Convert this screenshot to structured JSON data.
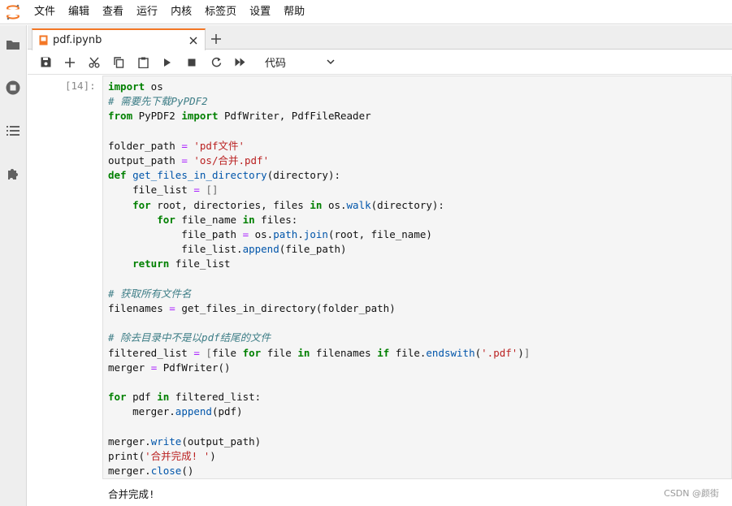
{
  "menu": [
    "文件",
    "编辑",
    "查看",
    "运行",
    "内核",
    "标签页",
    "设置",
    "帮助"
  ],
  "tab": {
    "title": "pdf.ipynb"
  },
  "toolbar": {
    "cell_type": "代码"
  },
  "cell": {
    "prompt": "[14]:",
    "output": "合并完成!"
  },
  "code_lines": [
    "import os",
    "# 需要先下载PyPDF2",
    "from PyPDF2 import PdfWriter, PdfFileReader",
    "",
    "folder_path = 'pdf文件'",
    "output_path = 'os/合并.pdf'",
    "def get_files_in_directory(directory):",
    "    file_list = []",
    "    for root, directories, files in os.walk(directory):",
    "        for file_name in files:",
    "            file_path = os.path.join(root, file_name)",
    "            file_list.append(file_path)",
    "    return file_list",
    "",
    "# 获取所有文件名",
    "filenames = get_files_in_directory(folder_path)",
    "",
    "# 除去目录中不是以pdf结尾的文件",
    "filtered_list = [file for file in filenames if file.endswith('.pdf')]",
    "merger = PdfWriter()",
    "",
    "for pdf in filtered_list:",
    "    merger.append(pdf)",
    "",
    "merger.write(output_path)",
    "print('合并完成! ')",
    "merger.close()"
  ],
  "watermark": "CSDN @颜街",
  "colors": {
    "accent": "#f37726",
    "keyword": "#008000",
    "comment": "#3d7d86",
    "string": "#ba2121"
  }
}
